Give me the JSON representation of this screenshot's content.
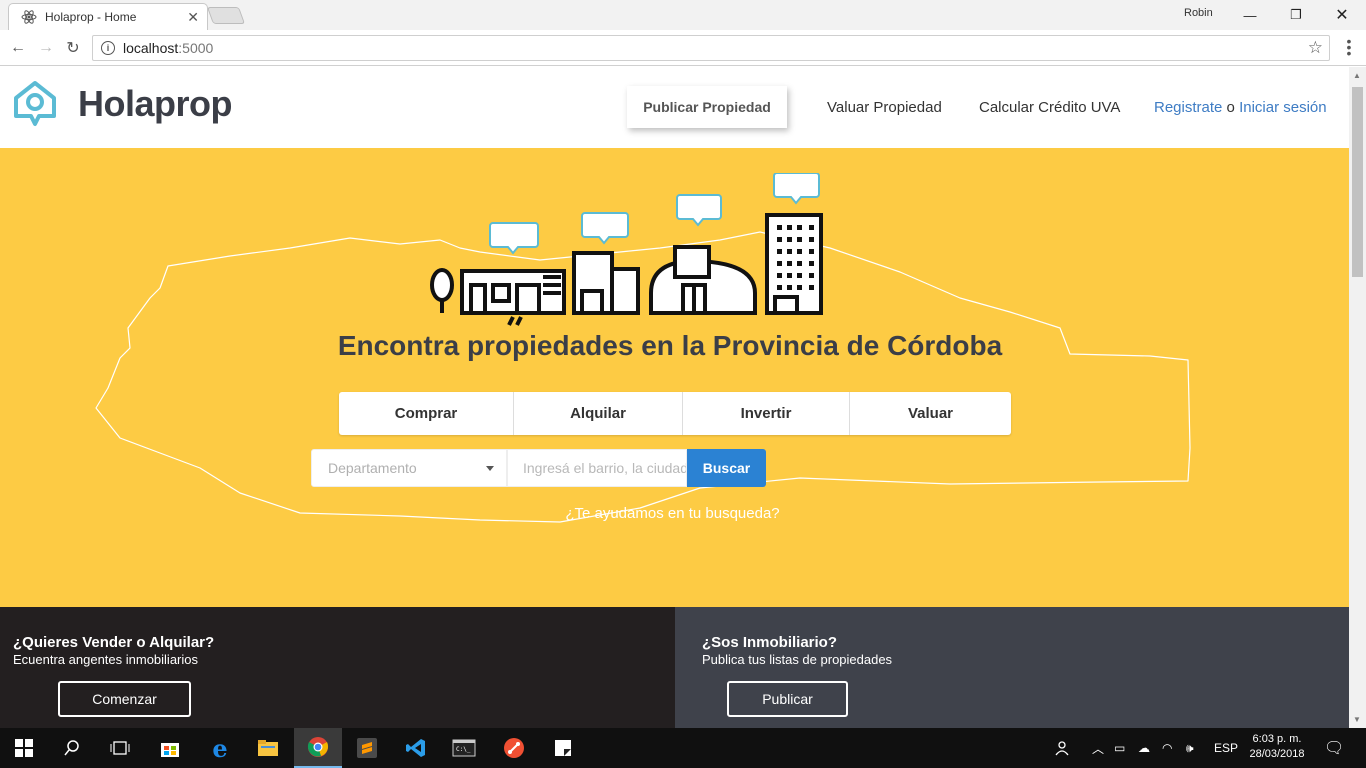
{
  "browser": {
    "tab_title": "Holaprop - Home",
    "profile_name": "Robin",
    "url_host": "localhost",
    "url_port": ":5000"
  },
  "header": {
    "logo_text": "Holaprop",
    "nav": {
      "publish": "Publicar Propiedad",
      "valuate": "Valuar Propiedad",
      "credit": "Calcular Crédito UVA",
      "register": "Registrate",
      "or": "o",
      "login": "Iniciar sesión"
    }
  },
  "hero": {
    "title": "Encontra propiedades en la Provincia de Córdoba",
    "operations": [
      "Comprar",
      "Alquilar",
      "Invertir",
      "Valuar"
    ],
    "department_placeholder": "Departamento",
    "search_placeholder": "Ingresá el barrio, la ciudad",
    "search_button": "Buscar",
    "help_link": "¿Te ayudamos en tu busqueda?",
    "colors": {
      "background": "#fdcb44",
      "search_button": "#2b82d3"
    }
  },
  "panels": {
    "sell": {
      "title": "¿Quieres Vender o Alquilar?",
      "subtitle": "Ecuentra angentes inmobiliarios",
      "button": "Comenzar"
    },
    "agency": {
      "title": "¿Sos Inmobiliario?",
      "subtitle": "Publica tus listas de propiedades",
      "button": "Publicar"
    }
  },
  "taskbar": {
    "apps": [
      "start-icon",
      "search-icon",
      "task-view-icon",
      "store-icon",
      "edge-icon",
      "file-explorer-icon",
      "chrome-icon",
      "sublime-icon",
      "vscode-icon",
      "terminal-icon",
      "git-icon",
      "notes-icon"
    ],
    "language": "ESP",
    "time": "6:03 p. m.",
    "date": "28/03/2018"
  }
}
